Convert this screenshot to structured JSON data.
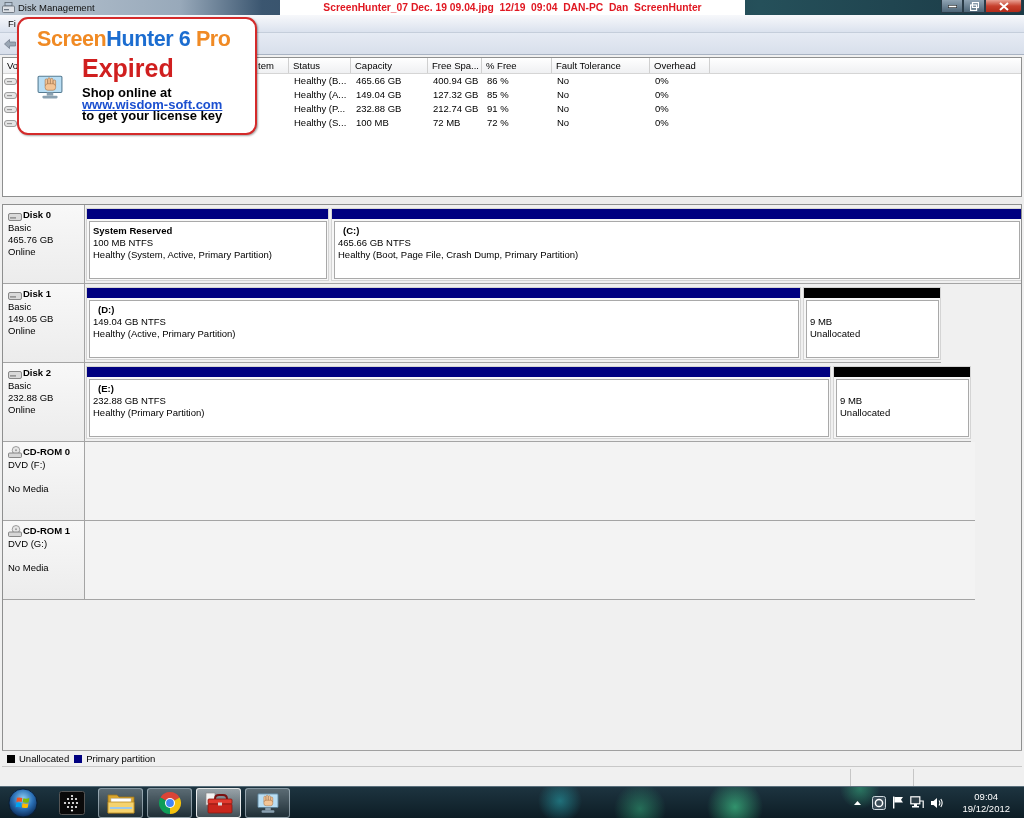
{
  "window": {
    "title": "Disk Management"
  },
  "capture_stamp": {
    "text": "ScreenHunter_07 Dec. 19 09.04.jpg  12/19  09:04  DAN-PC  Dan  ScreenHunter"
  },
  "menu_bar": [
    {
      "label": "Fi"
    }
  ],
  "volume_list": {
    "columns": [
      "Vo",
      "tem",
      "Status",
      "Capacity",
      "Free Spa...",
      "% Free",
      "Fault Tolerance",
      "Overhead"
    ],
    "rows": [
      {
        "cells": [
          "",
          "",
          "Healthy (B...",
          "465.66 GB",
          "400.94 GB",
          "86 %",
          "No",
          "0%"
        ]
      },
      {
        "cells": [
          "",
          "",
          "Healthy (A...",
          "149.04 GB",
          "127.32 GB",
          "85 %",
          "No",
          "0%"
        ]
      },
      {
        "cells": [
          "",
          "",
          "Healthy (P...",
          "232.88 GB",
          "212.74 GB",
          "91 %",
          "No",
          "0%"
        ]
      },
      {
        "cells": [
          "",
          "",
          "Healthy (S...",
          "100 MB",
          "72 MB",
          "72 %",
          "No",
          "0%"
        ]
      }
    ]
  },
  "disks": [
    {
      "kind": "disk",
      "name": "Disk 0",
      "type": "Basic",
      "size": "465.76 GB",
      "state": "Online",
      "partitions": [
        {
          "kind": "primary",
          "label": "System Reserved",
          "size": "100 MB NTFS",
          "status": "Healthy (System, Active, Primary Partition)"
        },
        {
          "kind": "primary",
          "drive": "(C:)",
          "size": "465.66 GB NTFS",
          "status": "Healthy (Boot, Page File, Crash Dump, Primary Partition)"
        }
      ]
    },
    {
      "kind": "disk",
      "name": "Disk 1",
      "type": "Basic",
      "size": "149.05 GB",
      "state": "Online",
      "partitions": [
        {
          "kind": "primary",
          "drive": "(D:)",
          "size": "149.04 GB NTFS",
          "status": "Healthy (Active, Primary Partition)"
        },
        {
          "kind": "unallocated",
          "size": "9 MB",
          "status": "Unallocated"
        }
      ]
    },
    {
      "kind": "disk",
      "name": "Disk 2",
      "type": "Basic",
      "size": "232.88 GB",
      "state": "Online",
      "partitions": [
        {
          "kind": "primary",
          "drive": "(E:)",
          "size": "232.88 GB NTFS",
          "status": "Healthy (Primary Partition)"
        },
        {
          "kind": "unallocated",
          "size": "9 MB",
          "status": "Unallocated"
        }
      ]
    },
    {
      "kind": "cdrom",
      "name": "CD-ROM 0",
      "type": "DVD (F:)",
      "state": "No Media"
    },
    {
      "kind": "cdrom",
      "name": "CD-ROM 1",
      "type": "DVD (G:)",
      "state": "No Media"
    }
  ],
  "legend": [
    {
      "kind": "unallocated",
      "label": "Unallocated",
      "color": "#000000"
    },
    {
      "kind": "primary",
      "label": "Primary partition",
      "color": "#000080"
    }
  ],
  "trial_notice": {
    "logo": [
      {
        "text": "Screen",
        "color": "#f08a24"
      },
      {
        "text": "Hunter 6",
        "color": "#1c6dd0"
      },
      {
        "text": " Pro",
        "color": "#f08a24"
      }
    ],
    "status": "Expired",
    "line": "Shop online at",
    "link": "www.wisdom-soft.com",
    "footer": "to get your license key"
  },
  "taskbar": {
    "apps": [
      {
        "kind": "grid",
        "running": false,
        "selected": false
      },
      {
        "kind": "folder",
        "running": true,
        "selected": false
      },
      {
        "kind": "browser",
        "running": true,
        "selected": false
      },
      {
        "kind": "toolbox",
        "running": true,
        "selected": true
      },
      {
        "kind": "hand",
        "running": true,
        "selected": false
      }
    ],
    "clock": {
      "time": "09:04",
      "date": "19/12/2012"
    }
  }
}
